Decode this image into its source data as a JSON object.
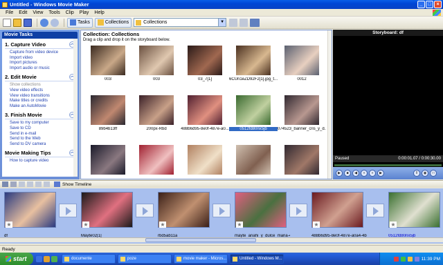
{
  "window": {
    "title": "Untitled - Windows Movie Maker",
    "btn_min": "_",
    "btn_max": "□",
    "btn_close": "×"
  },
  "menu": [
    "File",
    "Edit",
    "View",
    "Tools",
    "Clip",
    "Play",
    "Help"
  ],
  "toolbar": {
    "tasks_label": "Tasks",
    "collections_label": "Collections",
    "combo_value": "Collections"
  },
  "tasks_panel": {
    "header": "Movie Tasks",
    "sections": [
      {
        "title": "1. Capture Video",
        "links": [
          "Capture from video device",
          "Import video",
          "Import pictures",
          "Import audio or music"
        ]
      },
      {
        "title": "2. Edit Movie",
        "links": [
          "Show collections",
          "View video effects",
          "View video transitions",
          "Make titles or credits",
          "Make an AutoMovie"
        ]
      },
      {
        "title": "3. Finish Movie",
        "links": [
          "Save to my computer",
          "Save to CD",
          "Send in e-mail",
          "Send to the Web",
          "Send to DV camera"
        ]
      },
      {
        "title": "Movie Making Tips",
        "links": [
          "How to capture video"
        ]
      }
    ]
  },
  "collection": {
    "title": "Collection: Collections",
    "subtitle": "Drag a clip and drop it on the storyboard below.",
    "clips": [
      {
        "label": "003",
        "c1": "#3a2a20",
        "c2": "#c9a888"
      },
      {
        "label": "003",
        "c1": "#6a5040",
        "c2": "#e0c8b0"
      },
      {
        "label": "03_7[1]",
        "c1": "#2a1a18",
        "c2": "#a06850"
      },
      {
        "label": "6CUn1eZD92F2[1].jpg_t...",
        "c1": "#4a3020",
        "c2": "#d8b890"
      },
      {
        "label": "0012",
        "c1": "#5a6070",
        "c2": "#e8d0c0"
      },
      {
        "label": "89b4b13ff",
        "c1": "#2a2830",
        "c2": "#c08870"
      },
      {
        "label": "200px-Rbd",
        "c1": "#3a2028",
        "c2": "#c8a088"
      },
      {
        "label": "488b6d95-8e0f-487e-a0...",
        "c1": "#502030",
        "c2": "#e09080"
      },
      {
        "label": "0512fd80nx5jb",
        "c1": "#3a6a30",
        "c2": "#c0d0a0"
      },
      {
        "label": "074523_banner_cris_y_d...",
        "c1": "#302830",
        "c2": "#b89890"
      },
      {
        "label": "",
        "c1": "#1a1a2a",
        "c2": "#8a7880"
      },
      {
        "label": "",
        "c1": "#a02030",
        "c2": "#f0c0c0"
      },
      {
        "label": "",
        "c1": "#b08060",
        "c2": "#f0e0c8"
      },
      {
        "label": "",
        "c1": "#d0c0b0",
        "c2": "#806050"
      },
      {
        "label": "",
        "c1": "#302830",
        "c2": "#a07868"
      },
      {
        "label": "",
        "c1": "#201818",
        "c2": "#c0a080"
      }
    ]
  },
  "preview": {
    "title": "Storyboard: df",
    "status": "Paused",
    "time": "0:00:01.07 / 0:00:30.00"
  },
  "storyboard": {
    "toggle_label": "Show Timeline",
    "items": [
      {
        "label": "df",
        "c1": "#2a3a80",
        "c2": "#e8c0a0"
      },
      {
        "label": "Mayte02[1]",
        "c1": "#1a1a1a",
        "c2": "#e07080"
      },
      {
        "label": "rbd5ab11a",
        "c1": "#3a2018",
        "c2": "#c09070"
      },
      {
        "label": "mayte_anahi_y_dulce_maria-4...",
        "c1": "#e06080",
        "c2": "#4a7040"
      },
      {
        "label": "488b6d95-8e0f-487e-a0a4-4b...",
        "c1": "#6a1a20",
        "c2": "#d0a090"
      },
      {
        "label": "0512fd80nx5jb",
        "c1": "#3a7030",
        "c2": "#e0e0d0"
      }
    ]
  },
  "status_text": "Ready",
  "taskbar": {
    "start": "start",
    "tasks": [
      "documente",
      "poze",
      "movie maker - Micros...",
      "Untitled - Windows M..."
    ],
    "lang": "EN",
    "clock": "11:39 PM"
  }
}
